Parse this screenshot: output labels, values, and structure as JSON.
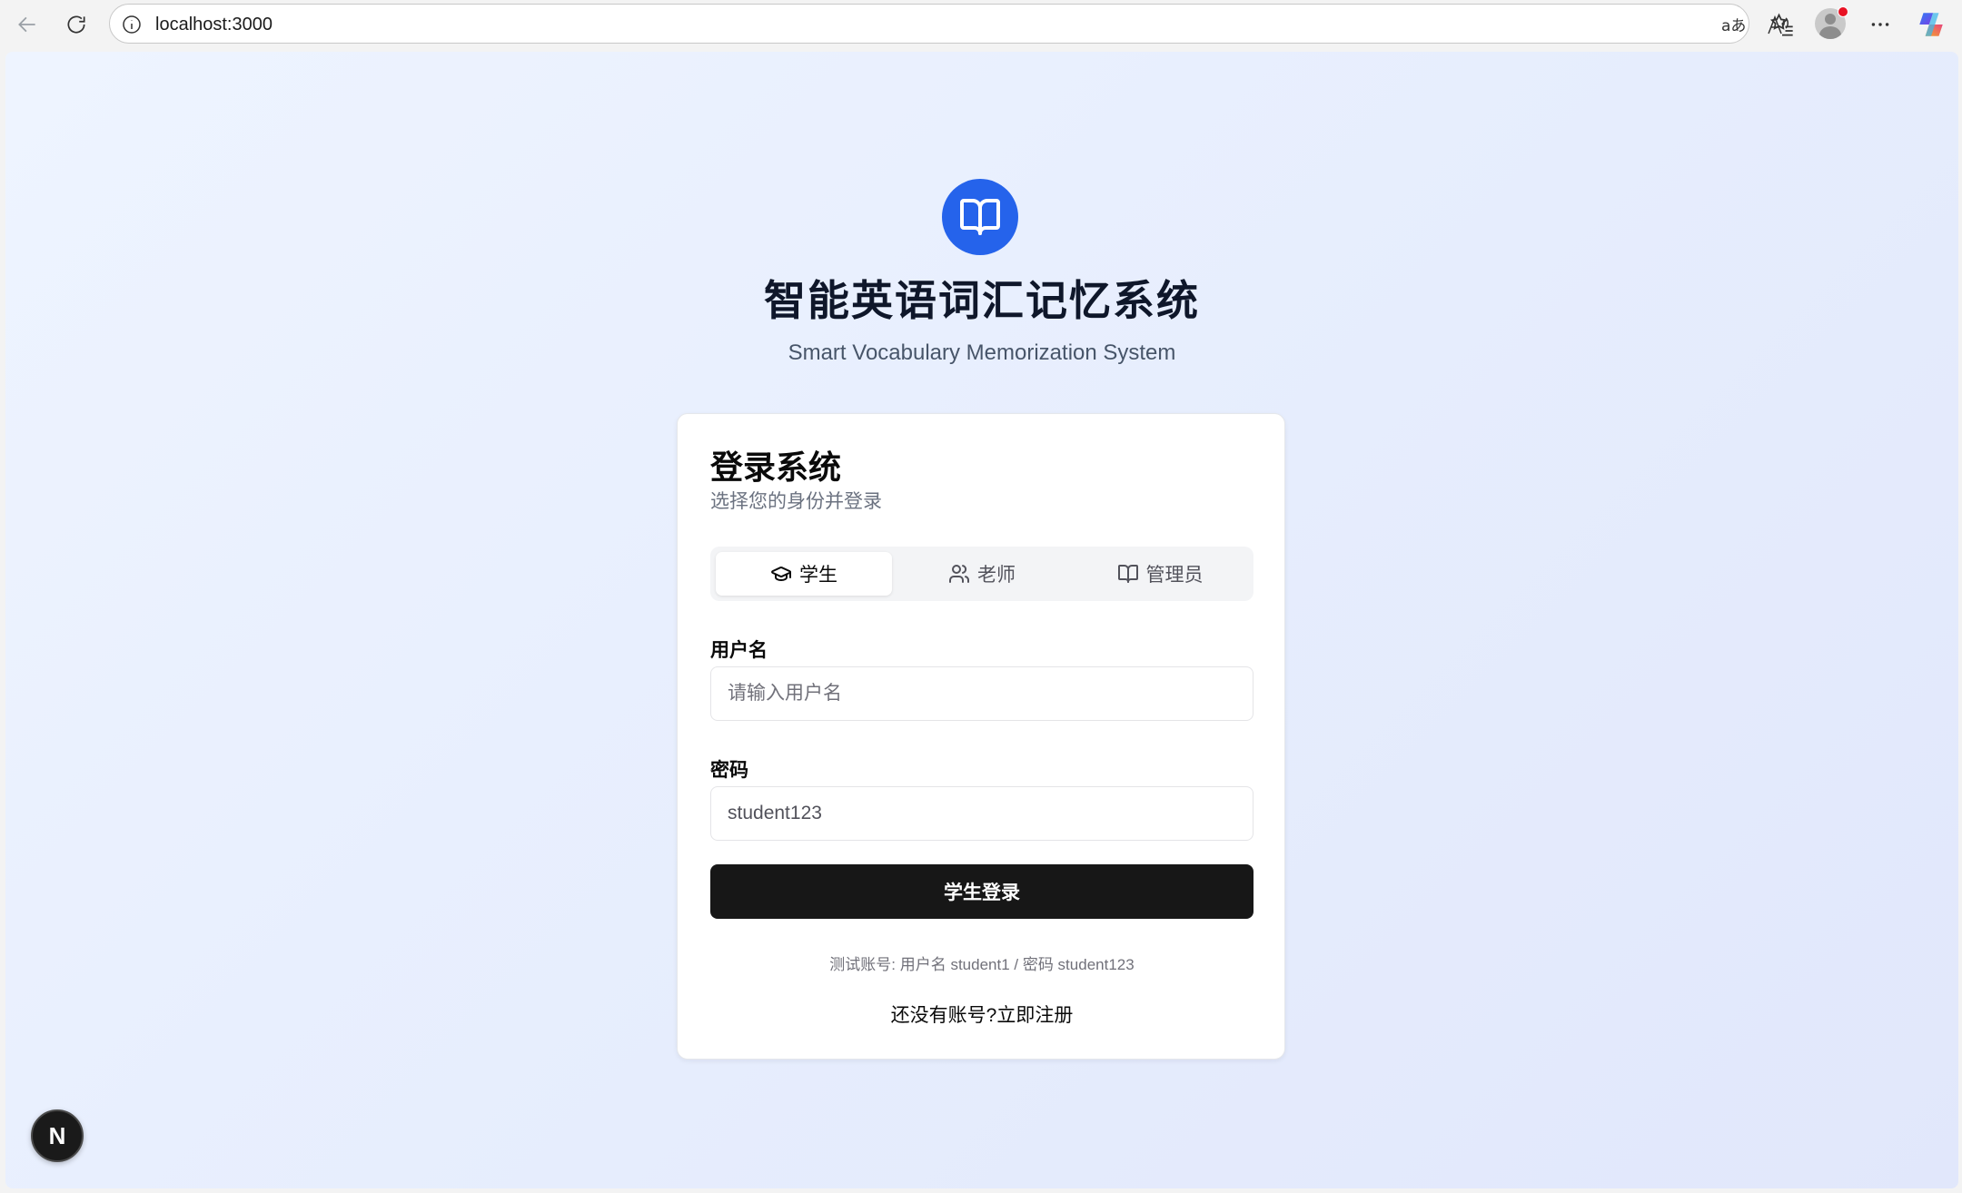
{
  "browser": {
    "url": "localhost:3000",
    "read_aloud_label": "Ă"
  },
  "app": {
    "title": "智能英语词汇记忆系统",
    "subtitle": "Smart Vocabulary Memorization System"
  },
  "login_card": {
    "title": "登录系统",
    "description": "选择您的身份并登录",
    "tabs": [
      {
        "label": "学生",
        "icon": "graduation-cap-icon",
        "active": true
      },
      {
        "label": "老师",
        "icon": "users-icon",
        "active": false
      },
      {
        "label": "管理员",
        "icon": "book-open-icon",
        "active": false
      }
    ],
    "username": {
      "label": "用户名",
      "placeholder": "请输入用户名",
      "value": ""
    },
    "password": {
      "label": "密码",
      "value": "student123"
    },
    "submit_label": "学生登录",
    "hint": "测试账号: 用户名 student1 / 密码 student123",
    "register_prefix": "还没有账号?",
    "register_link": "立即注册"
  },
  "dev_badge": {
    "label": "N"
  }
}
